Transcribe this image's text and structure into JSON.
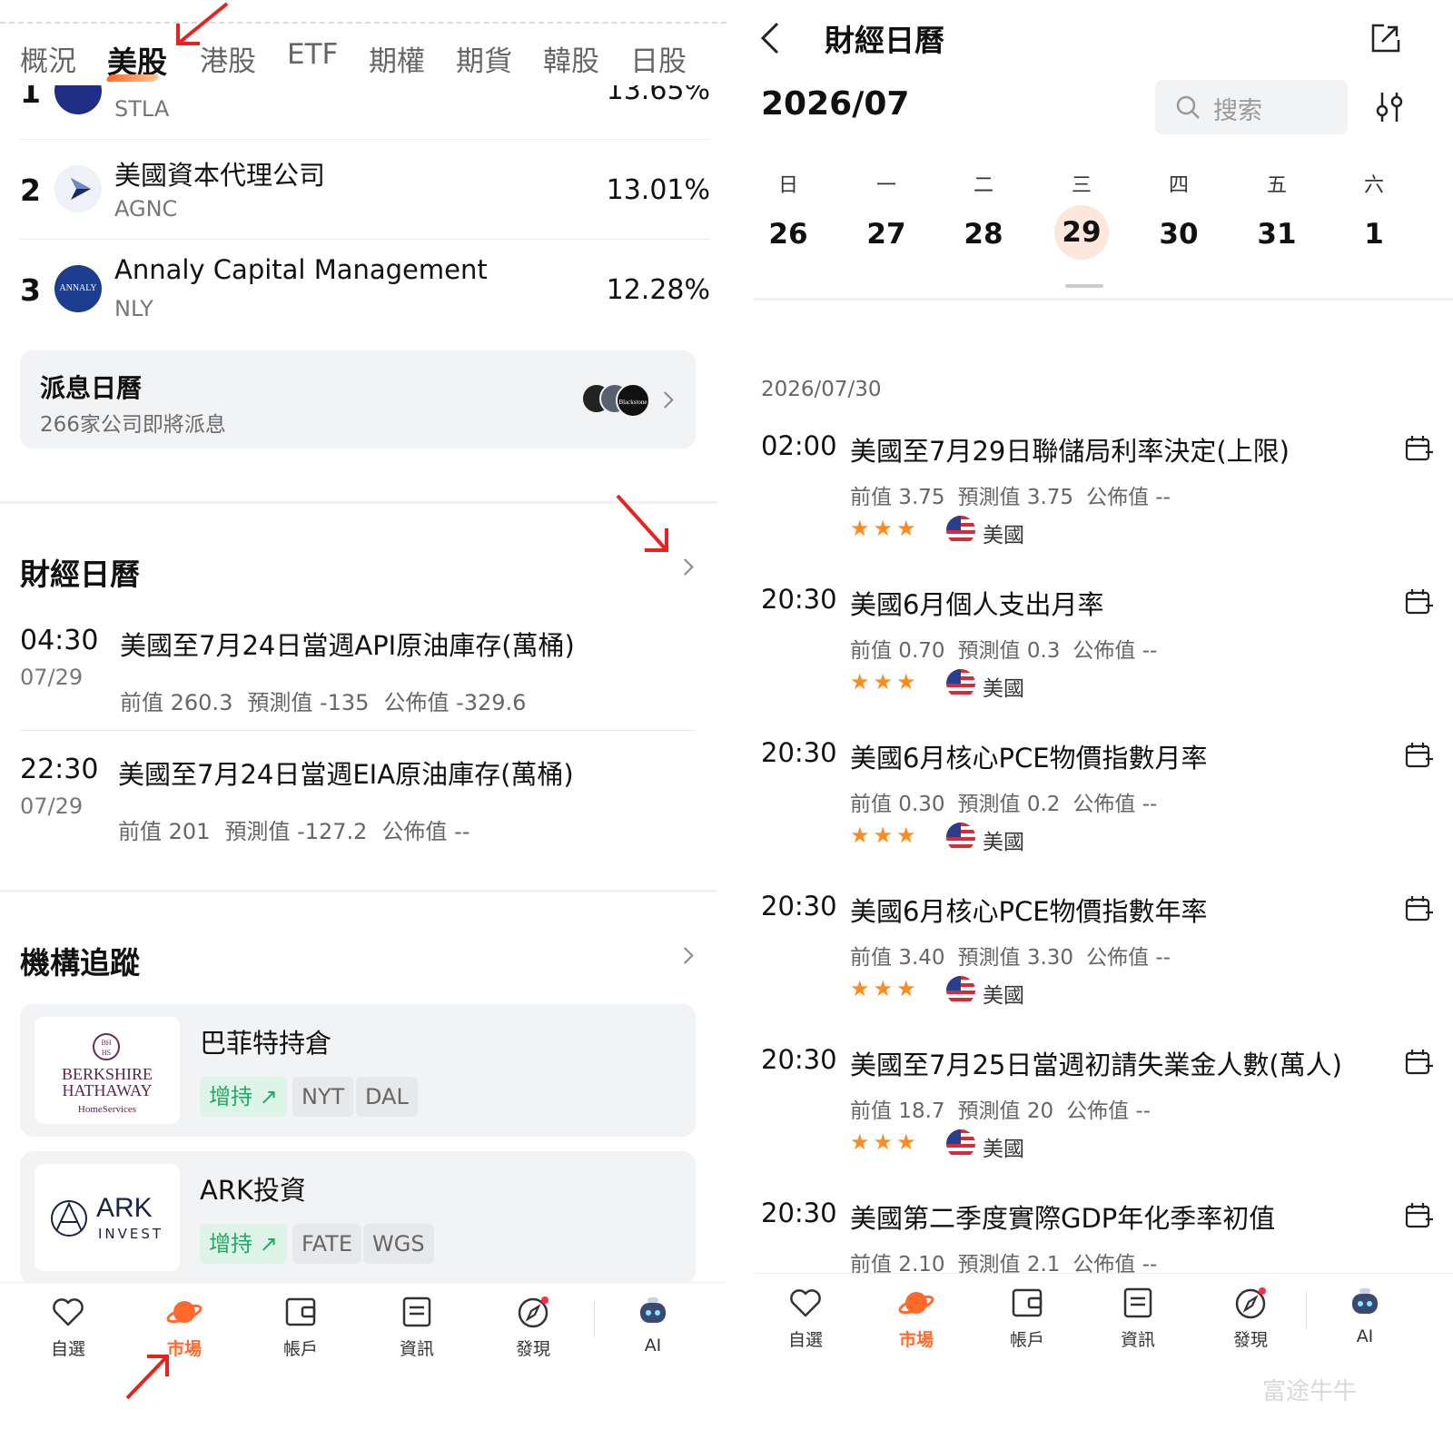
{
  "left": {
    "tabs": [
      "概況",
      "美股",
      "港股",
      "ETF",
      "期權",
      "期貨",
      "韓股",
      "日股"
    ],
    "active_tab": "美股",
    "rankings": [
      {
        "num": "1",
        "name": "",
        "code": "STLA",
        "pct": "13.65%"
      },
      {
        "num": "2",
        "name": "美國資本代理公司",
        "code": "AGNC",
        "pct": "13.01%"
      },
      {
        "num": "3",
        "name": "Annaly Capital Management",
        "code": "NLY",
        "pct": "12.28%",
        "logo_text": "ANNALY"
      }
    ],
    "dividend": {
      "title": "派息日曆",
      "subtitle": "266家公司即將派息",
      "logo_text": "Blackstone"
    },
    "calendar": {
      "title": "財經日曆",
      "events": [
        {
          "time": "04:30",
          "date": "07/29",
          "title": "美國至7月24日當週API原油庫存(萬桶)",
          "prev": "前值 260.3",
          "forecast": "預測值 -135",
          "actual": "公佈值 -329.6"
        },
        {
          "time": "22:30",
          "date": "07/29",
          "title": "美國至7月24日當週EIA原油庫存(萬桶)",
          "prev": "前值 201",
          "forecast": "預測值 -127.2",
          "actual": "公佈值 --"
        }
      ]
    },
    "institutions": {
      "title": "機構追蹤",
      "items": [
        {
          "name": "巴菲特持倉",
          "tag": "增持",
          "stocks": [
            "NYT",
            "DAL"
          ],
          "logo_lines": [
            "BH",
            "HS",
            "BERKSHIRE",
            "HATHAWAY",
            "HomeServices"
          ]
        },
        {
          "name": "ARK投資",
          "tag": "增持",
          "stocks": [
            "FATE",
            "WGS"
          ],
          "logo_lines": [
            "ARK",
            "INVEST"
          ]
        }
      ]
    }
  },
  "nav": [
    {
      "label": "自選",
      "icon": "heart-icon"
    },
    {
      "label": "市場",
      "icon": "planet-icon",
      "active": true
    },
    {
      "label": "帳戶",
      "icon": "wallet-icon"
    },
    {
      "label": "資訊",
      "icon": "news-icon"
    },
    {
      "label": "發現",
      "icon": "compass-icon"
    },
    {
      "label": "AI",
      "icon": "robot-icon"
    }
  ],
  "right": {
    "title": "財經日曆",
    "month": "2026/07",
    "search_placeholder": "搜索",
    "weekdays": [
      "日",
      "一",
      "二",
      "三",
      "四",
      "五",
      "六"
    ],
    "days": [
      "26",
      "27",
      "28",
      "29",
      "30",
      "31",
      "1"
    ],
    "selected_day": "29",
    "date_header": "2026/07/30",
    "events": [
      {
        "time": "02:00",
        "title": "美國至7月29日聯儲局利率決定(上限)",
        "prev": "前值 3.75",
        "forecast": "預測值 3.75",
        "actual": "公佈值 --",
        "stars": "★★★",
        "country": "美國"
      },
      {
        "time": "20:30",
        "title": "美國6月個人支出月率",
        "prev": "前值 0.70",
        "forecast": "預測值 0.3",
        "actual": "公佈值 --",
        "stars": "★★★",
        "country": "美國"
      },
      {
        "time": "20:30",
        "title": "美國6月核心PCE物價指數月率",
        "prev": "前值 0.30",
        "forecast": "預測值 0.2",
        "actual": "公佈值 --",
        "stars": "★★★",
        "country": "美國"
      },
      {
        "time": "20:30",
        "title": "美國6月核心PCE物價指數年率",
        "prev": "前值 3.40",
        "forecast": "預測值 3.30",
        "actual": "公佈值 --",
        "stars": "★★★",
        "country": "美國"
      },
      {
        "time": "20:30",
        "title": "美國至7月25日當週初請失業金人數(萬人)",
        "prev": "前值 18.7",
        "forecast": "預測值 20",
        "actual": "公佈值 --",
        "stars": "★★★",
        "country": "美國"
      },
      {
        "time": "20:30",
        "title": "美國第二季度實際GDP年化季率初值",
        "prev": "前值 2.10",
        "forecast": "預測值 2.1",
        "actual": "公佈值 --"
      }
    ]
  },
  "watermark": "富途牛牛",
  "colors": {
    "accent": "#ff6a2c",
    "green": "#1faa63",
    "star": "#ff8a1e",
    "annotation_arrow": "#e8231f"
  }
}
